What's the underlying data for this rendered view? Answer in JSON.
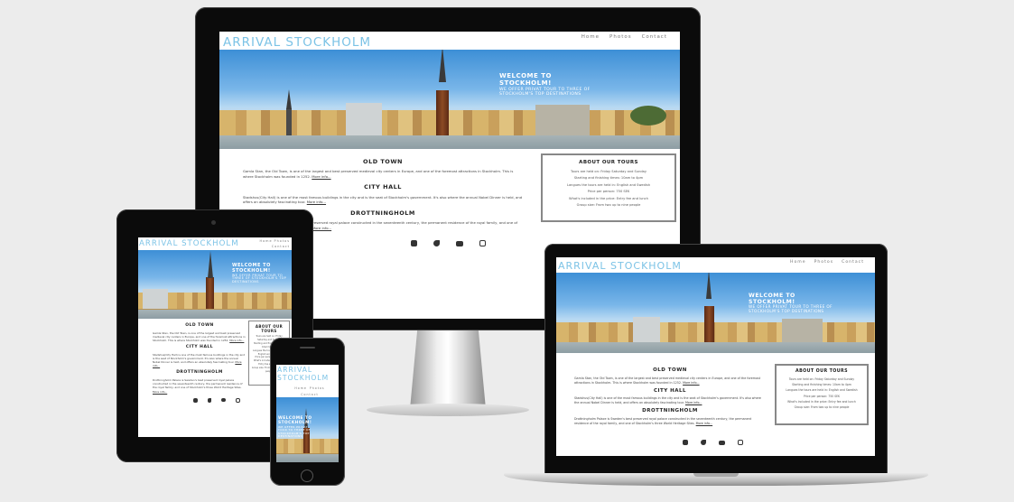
{
  "site": {
    "brand": "ARRIVAL STOCKHOLM",
    "nav": [
      "Home",
      "Photos",
      "Contact"
    ],
    "hero_heading": "WELCOME TO STOCKHOLM!",
    "hero_sub": "WE OFFER PRIVAT TOUR TO THREE OF STOCKHOLM'S TOP DESTINATIONS",
    "sections": [
      {
        "title": "OLD TOWN",
        "text": "Gamla Stan, the Old Town, is one of the largest and best preserved medieval city centers in Europe, and one of the foremost attractions in Stockholm. This is where Stockholm was founded in 1252.",
        "more": "More info..."
      },
      {
        "title": "CITY HALL",
        "text": "Stadshus(City Hall) is one of the most famous buildings in the city and is the seat of Stockholm's government. It's also where the annual Nobel Dinner is held, and offers an absolutely fascinating tour.",
        "more": "More info..."
      },
      {
        "title": "DROTTNINGHOLM",
        "text": "Drottningholm Palace is Sweden's best preserved royal palace constructed in the seventeenth century, the permanent residence of the royal family, and one of Stockholm's three World Heritage Sites.",
        "more": "More info..."
      }
    ],
    "tours": {
      "title": "ABOUT OUR TOURS",
      "lines": [
        "Tours are held on: Friday Saturday and Sunday",
        "Starting and finishing times: 10am to 4pm",
        "Langues the tours are held in: English and Swedish",
        "Price per person: 750 SEK",
        "What's included in the price: Entry fee and lunch",
        "Group size: From two up to nine people"
      ]
    },
    "social": [
      "facebook-icon",
      "twitter-icon",
      "youtube-icon",
      "instagram-icon"
    ]
  },
  "colors": {
    "brand": "#7cc3e6",
    "background": "#ececec",
    "bezel": "#0a0a0a"
  }
}
